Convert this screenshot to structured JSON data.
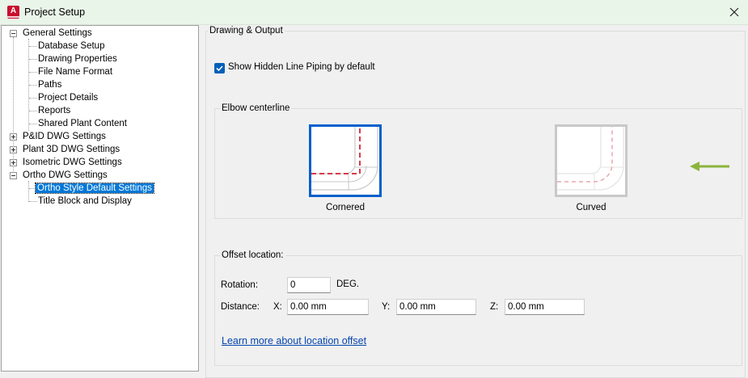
{
  "window": {
    "title": "Project Setup",
    "icon": "autocad-plant-icon"
  },
  "tree": {
    "items": [
      {
        "label": "General Settings",
        "expander": "minus"
      },
      {
        "label": "Database Setup"
      },
      {
        "label": "Drawing Properties"
      },
      {
        "label": "File Name Format"
      },
      {
        "label": "Paths"
      },
      {
        "label": "Project Details"
      },
      {
        "label": "Reports"
      },
      {
        "label": "Shared Plant Content"
      },
      {
        "label": "P&ID DWG Settings",
        "expander": "plus"
      },
      {
        "label": "Plant 3D DWG Settings",
        "expander": "plus"
      },
      {
        "label": "Isometric DWG Settings",
        "expander": "plus"
      },
      {
        "label": "Ortho DWG Settings",
        "expander": "minus"
      },
      {
        "label": "Ortho Style Default Settings",
        "selected": true
      },
      {
        "label": "Title Block and Display"
      }
    ]
  },
  "main": {
    "section_title": "Drawing & Output",
    "show_hidden_checkbox": {
      "label": "Show Hidden Line Piping by default",
      "checked": true
    },
    "elbow": {
      "group_label": "Elbow centerline",
      "options": [
        {
          "label": "Cornered",
          "selected": true
        },
        {
          "label": "Curved",
          "selected": false
        }
      ],
      "arrow_color": "#8cb43c"
    },
    "offset": {
      "group_label": "Offset location:",
      "rotation_label": "Rotation:",
      "rotation_value": "0",
      "rotation_unit": "DEG.",
      "distance_label": "Distance:",
      "x_label": "X:",
      "x_value": "0.00 mm",
      "y_label": "Y:",
      "y_value": "0.00 mm",
      "z_label": "Z:",
      "z_value": "0.00 mm"
    },
    "learn_more_link": "Learn more about location offset"
  },
  "colors": {
    "accent": "#005fb8",
    "selection": "#0078d7",
    "link": "#0645ad",
    "centerline": "#d63a4a"
  }
}
